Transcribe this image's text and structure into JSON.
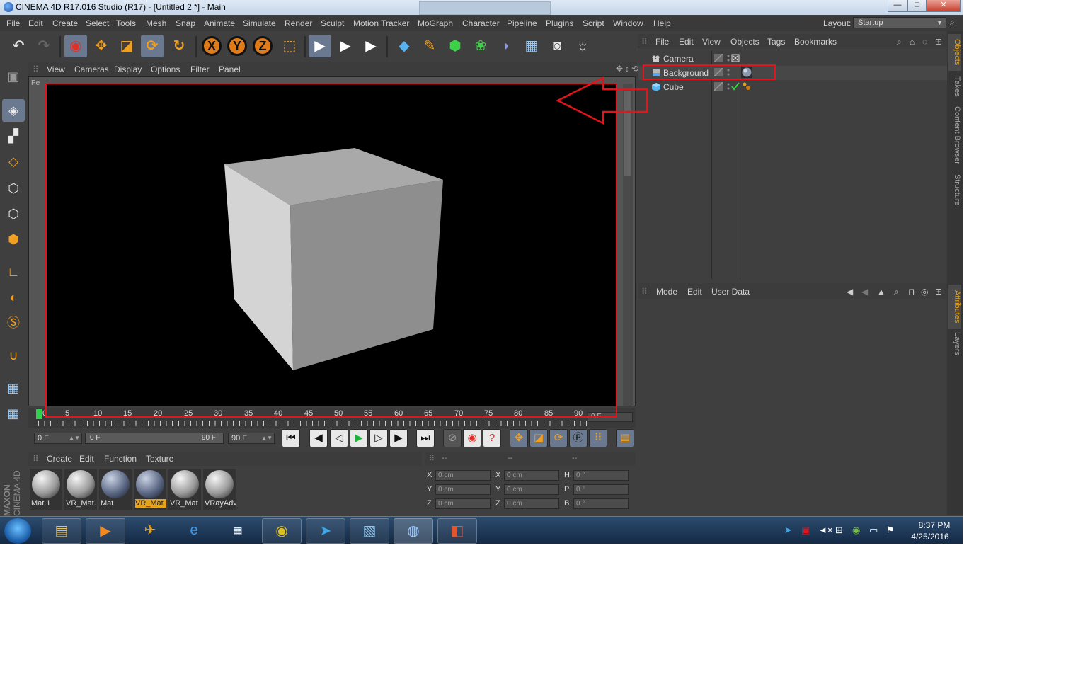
{
  "window": {
    "title": "CINEMA 4D R17.016 Studio (R17) - [Untitled 2 *] - Main",
    "minimize": "—",
    "maximize": "□",
    "close": "✕"
  },
  "menu": {
    "items": [
      "File",
      "Edit",
      "Create",
      "Select",
      "Tools",
      "Mesh",
      "Snap",
      "Animate",
      "Simulate",
      "Render",
      "Sculpt",
      "Motion Tracker",
      "MoGraph",
      "Character",
      "Pipeline",
      "Plugins",
      "Script",
      "Window",
      "Help"
    ],
    "layout_label": "Layout:",
    "layout_value": "Startup"
  },
  "toolbar": {
    "axis_x": "X",
    "axis_y": "Y",
    "axis_z": "Z"
  },
  "viewport": {
    "menu": [
      "View",
      "Cameras",
      "Display",
      "Options",
      "Filter",
      "Panel"
    ],
    "label": "Pe"
  },
  "timeline": {
    "ticks": [
      "0",
      "5",
      "10",
      "15",
      "20",
      "25",
      "30",
      "35",
      "40",
      "45",
      "50",
      "55",
      "60",
      "65",
      "70",
      "75",
      "80",
      "85",
      "90"
    ],
    "current_field": "0 F"
  },
  "playback": {
    "start_field": "0 F",
    "range_start": "0 F",
    "range_end": "90 F",
    "end_field": "90 F"
  },
  "material_manager": {
    "menu": [
      "Create",
      "Edit",
      "Function",
      "Texture"
    ],
    "materials": [
      {
        "name": "Mat.1",
        "style": "light",
        "selected": false
      },
      {
        "name": "VR_Mat.",
        "style": "light",
        "selected": false
      },
      {
        "name": "Mat",
        "style": "dark",
        "selected": false
      },
      {
        "name": "VR_Mat",
        "style": "dark",
        "selected": true
      },
      {
        "name": "VR_Mat",
        "style": "light",
        "selected": false
      },
      {
        "name": "VRayAdv",
        "style": "light",
        "selected": false
      }
    ],
    "logo_line1": "MAXON",
    "logo_line2": "CINEMA 4D"
  },
  "coordinates": {
    "headers": [
      "--",
      "--",
      "--"
    ],
    "rows": [
      {
        "l1": "X",
        "v1": "0 cm",
        "l2": "X",
        "v2": "0 cm",
        "l3": "H",
        "v3": "0 °"
      },
      {
        "l1": "Y",
        "v1": "0 cm",
        "l2": "Y",
        "v2": "0 cm",
        "l3": "P",
        "v3": "0 °"
      },
      {
        "l1": "Z",
        "v1": "0 cm",
        "l2": "Z",
        "v2": "0 cm",
        "l3": "B",
        "v3": "0 °"
      }
    ]
  },
  "object_manager": {
    "menu": [
      "File",
      "Edit",
      "View",
      "Objects",
      "Tags",
      "Bookmarks"
    ],
    "objects": [
      {
        "name": "Camera"
      },
      {
        "name": "Background"
      },
      {
        "name": "Cube"
      }
    ]
  },
  "attributes": {
    "menu": [
      "Mode",
      "Edit",
      "User Data"
    ]
  },
  "right_tabs": {
    "objects": "Objects",
    "takes": "Takes",
    "content_browser": "Content Browser",
    "structure": "Structure",
    "attributes": "Attributes",
    "layers": "Layers"
  },
  "taskbar": {
    "time": "8:37 PM",
    "date": "4/25/2016"
  },
  "colors": {
    "accent_orange": "#e6a21a",
    "annotation_red": "#e3141c",
    "panel_bg": "#3f3f3f"
  }
}
